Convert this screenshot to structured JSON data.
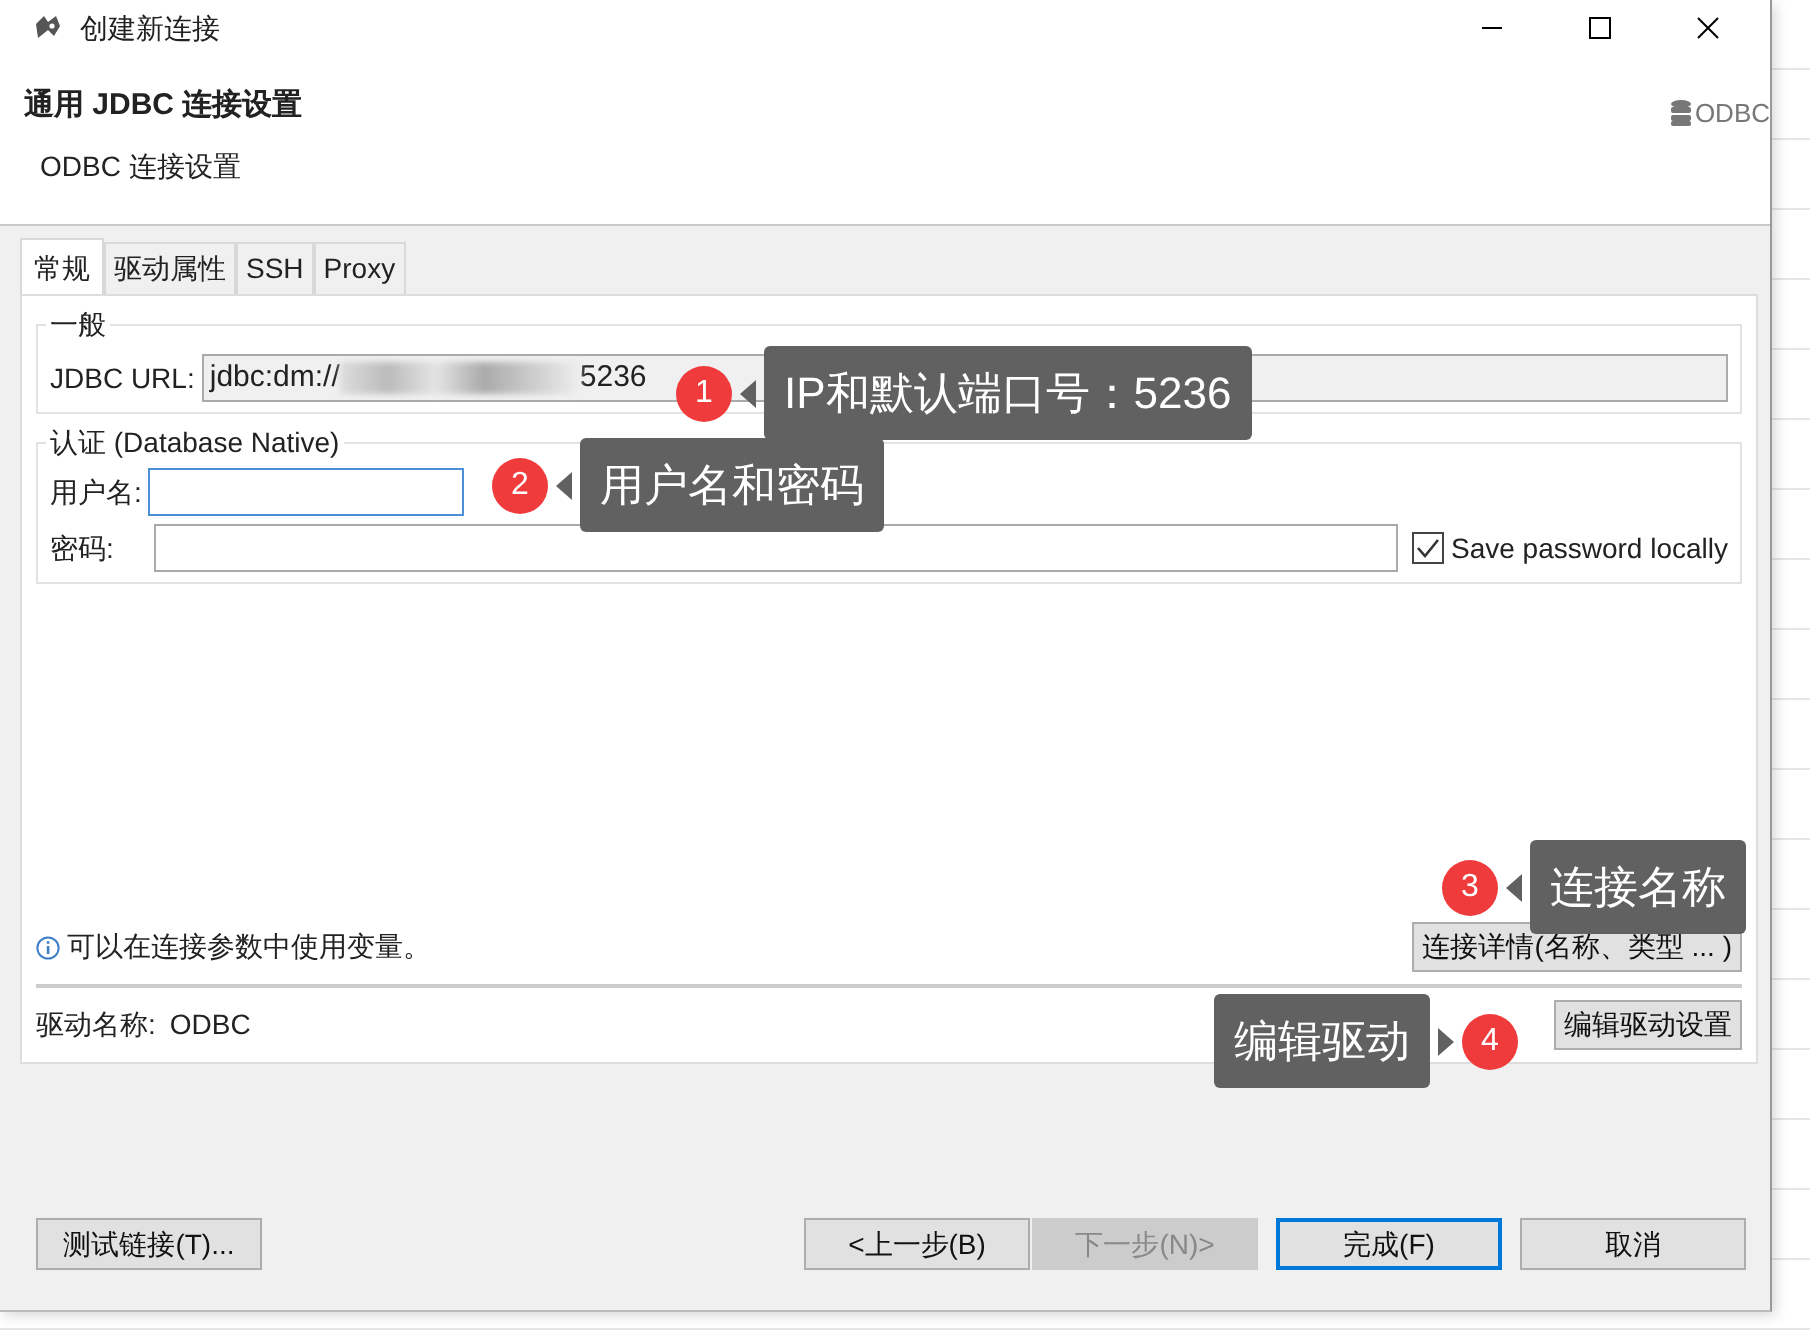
{
  "window": {
    "title": "创建新连接"
  },
  "header": {
    "title": "通用 JDBC 连接设置",
    "subtitle": "ODBC 连接设置",
    "logo_text": "ODBC"
  },
  "tabs": [
    {
      "label": "常规",
      "selected": true
    },
    {
      "label": "驱动属性",
      "selected": false
    },
    {
      "label": "SSH",
      "selected": false
    },
    {
      "label": "Proxy",
      "selected": false
    }
  ],
  "general": {
    "legend": "一般",
    "url_label": "JDBC URL:",
    "url_prefix": "jdbc:dm://",
    "url_suffix": "5236"
  },
  "auth": {
    "legend": "认证 (Database Native)",
    "username_label": "用户名:",
    "username_focused": true,
    "password_label": "密码:",
    "save_password": {
      "label": "Save password locally",
      "checked": true
    }
  },
  "info_text": "可以在连接参数中使用变量。",
  "details_button": "连接详情(名称、类型 ... )",
  "driver": {
    "label": "驱动名称:",
    "value": "ODBC",
    "edit_button": "编辑驱动设置"
  },
  "footer_buttons": [
    {
      "label": "测试链接(T)...",
      "disabled": false,
      "default": false
    },
    {
      "label": "<上一步(B)",
      "disabled": false,
      "default": false
    },
    {
      "label": "下一步(N)>",
      "disabled": true,
      "default": false
    },
    {
      "label": "完成(F)",
      "disabled": false,
      "default": true
    },
    {
      "label": "取消",
      "disabled": false,
      "default": false
    }
  ],
  "annotations": [
    {
      "number": "1",
      "text": "IP和默认端口号：5236"
    },
    {
      "number": "2",
      "text": "用户名和密码"
    },
    {
      "number": "3",
      "text": "连接名称"
    },
    {
      "number": "4",
      "text": "编辑驱动"
    }
  ]
}
